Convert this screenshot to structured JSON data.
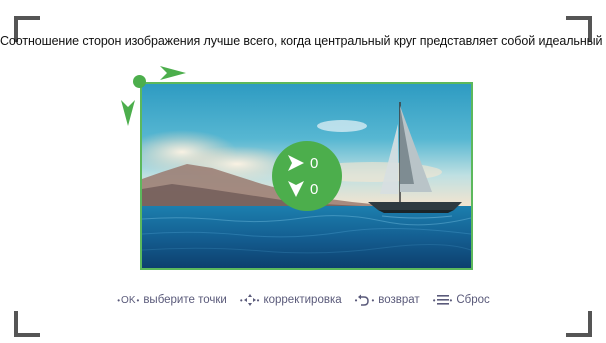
{
  "instruction": "Соотношение сторон изображения лучше всего, когда центральный круг представляет собой идеальный круг.",
  "offsets": {
    "x": "0",
    "y": "0"
  },
  "hints": [
    {
      "key": "OK",
      "label": "выберите точки",
      "icon": "ok-key-icon"
    },
    {
      "key": "",
      "label": "корректировка",
      "icon": "direction-pad-icon"
    },
    {
      "key": "",
      "label": "возврат",
      "icon": "back-icon"
    },
    {
      "key": "",
      "label": "Сброс",
      "icon": "menu-icon"
    }
  ],
  "colors": {
    "accent": "#4cae4c",
    "frame": "#5cb85c",
    "hint_text": "#5a5a7a"
  }
}
